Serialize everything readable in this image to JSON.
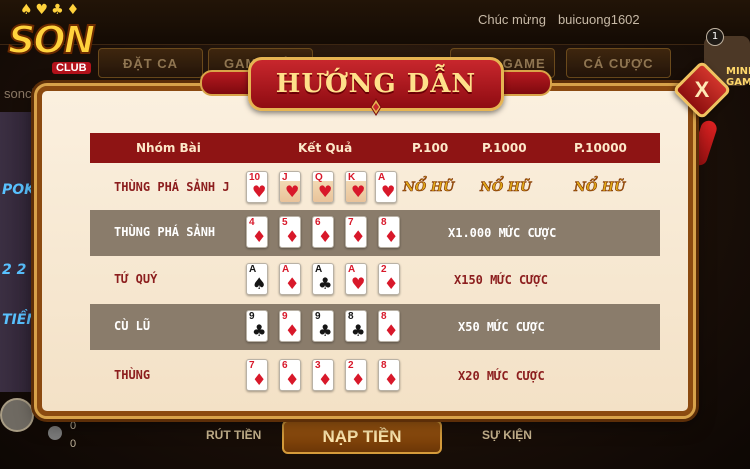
{
  "app": {
    "logo_text": "SON",
    "logo_club": "CLUB",
    "logo_url": "sonclub.mobi",
    "ticker_prefix": "Chúc mừng",
    "ticker_user": "buicuong1602"
  },
  "lobby_tabs": [
    "ĐẶT CA",
    "GAME BÀI",
    "",
    "SLOT GAME",
    "CÁ CƯỢC"
  ],
  "bottom_bar": {
    "withdraw": "RÚT TIỀN",
    "deposit": "NẠP TIỀN",
    "events": "SỰ KIỆN",
    "balance_1": "0",
    "balance_2": "0"
  },
  "side_badge": {
    "count": "1",
    "label": "MINI GAME"
  },
  "modal": {
    "title": "HƯỚNG DẪN",
    "close_label": "X",
    "headers": {
      "group": "Nhóm Bài",
      "result": "Kết Quả",
      "p100": "P.100",
      "p1000": "P.1000",
      "p10000": "P.10000"
    },
    "rows": [
      {
        "name": "THÙNG PHÁ SẢNH J",
        "cards": [
          {
            "rank": "10",
            "suit": "♥",
            "color": "red"
          },
          {
            "rank": "J",
            "suit": "♥",
            "color": "red"
          },
          {
            "rank": "Q",
            "suit": "♥",
            "color": "red"
          },
          {
            "rank": "K",
            "suit": "♥",
            "color": "red"
          },
          {
            "rank": "A",
            "suit": "♥",
            "color": "red"
          }
        ],
        "jackpot": [
          "NỔ HŨ",
          "NỔ HŨ",
          "NỔ HŨ"
        ]
      },
      {
        "name": "THÙNG PHÁ SẢNH",
        "cards": [
          {
            "rank": "4",
            "suit": "♦",
            "color": "red"
          },
          {
            "rank": "5",
            "suit": "♦",
            "color": "red"
          },
          {
            "rank": "6",
            "suit": "♦",
            "color": "red"
          },
          {
            "rank": "7",
            "suit": "♦",
            "color": "red"
          },
          {
            "rank": "8",
            "suit": "♦",
            "color": "red"
          }
        ],
        "payout": "X1.000 MỨC CƯỢC"
      },
      {
        "name": "TỨ QUÝ",
        "cards": [
          {
            "rank": "A",
            "suit": "♠",
            "color": "black"
          },
          {
            "rank": "A",
            "suit": "♦",
            "color": "red"
          },
          {
            "rank": "A",
            "suit": "♣",
            "color": "black"
          },
          {
            "rank": "A",
            "suit": "♥",
            "color": "red"
          },
          {
            "rank": "2",
            "suit": "♦",
            "color": "red"
          }
        ],
        "payout": "X150 MỨC CƯỢC"
      },
      {
        "name": "CÙ LŨ",
        "cards": [
          {
            "rank": "9",
            "suit": "♣",
            "color": "black"
          },
          {
            "rank": "9",
            "suit": "♦",
            "color": "red"
          },
          {
            "rank": "9",
            "suit": "♣",
            "color": "black"
          },
          {
            "rank": "8",
            "suit": "♣",
            "color": "black"
          },
          {
            "rank": "8",
            "suit": "♦",
            "color": "red"
          }
        ],
        "payout": "X50 MỨC CƯỢC"
      },
      {
        "name": "THÙNG",
        "cards": [
          {
            "rank": "7",
            "suit": "♦",
            "color": "red"
          },
          {
            "rank": "6",
            "suit": "♦",
            "color": "red"
          },
          {
            "rank": "3",
            "suit": "♦",
            "color": "red"
          },
          {
            "rank": "2",
            "suit": "♦",
            "color": "red"
          },
          {
            "rank": "8",
            "suit": "♦",
            "color": "red"
          }
        ],
        "payout": "X20 MỨC CƯỢC"
      }
    ]
  },
  "colors": {
    "header_red": "#8e1414",
    "row_dark": "#8a7c6b",
    "panel_cream": "#fbf0df",
    "title_gold": "#ffe08a"
  }
}
